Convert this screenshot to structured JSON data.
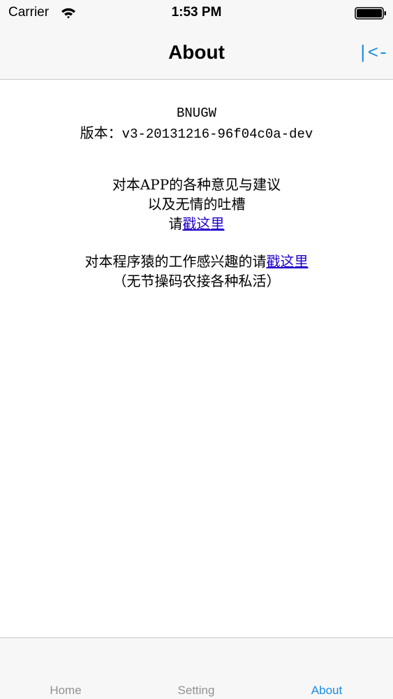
{
  "status_bar": {
    "carrier": "Carrier",
    "time": "1:53 PM",
    "wifi_icon": "wifi-icon",
    "battery_icon": "battery-icon"
  },
  "nav_bar": {
    "title": "About",
    "back_label": "|<-",
    "accent_color": "#1a8be6"
  },
  "about": {
    "app_name": "BNUGW",
    "version_label": "版本：",
    "version_value": "v3-20131216-96f04c0a-dev",
    "feedback_line1": "对本APP的各种意见与建议",
    "feedback_line2": "以及无情的吐槽",
    "feedback_prefix": "请",
    "feedback_link": "戳这里",
    "job_text": "对本程序猿的工作感兴趣的请",
    "job_link": "戳这里",
    "job_note": "（无节操码农接各种私活）",
    "link_color": "#2200cc"
  },
  "tab_bar": {
    "tabs": [
      {
        "label": "Home"
      },
      {
        "label": "Setting"
      },
      {
        "label": "About"
      }
    ],
    "active": "About",
    "inactive_color": "#929292",
    "active_color": "#1a8be6"
  }
}
